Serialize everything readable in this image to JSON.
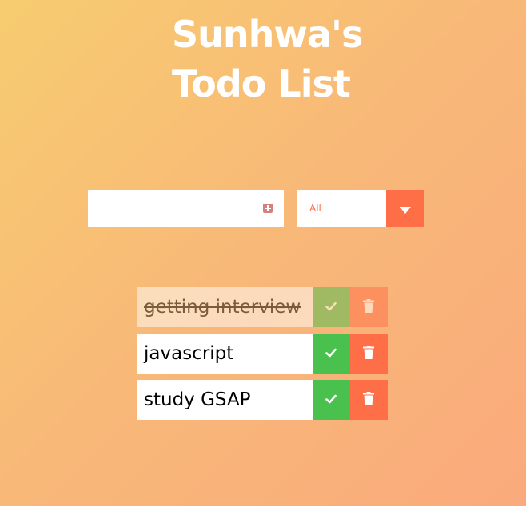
{
  "header": {
    "title_line1": "Sunhwa's",
    "title_line2": "Todo List"
  },
  "add_form": {
    "input_value": "",
    "add_icon": "plus-square-icon"
  },
  "filter": {
    "selected": "All",
    "arrow_icon": "caret-down-icon"
  },
  "todos": [
    {
      "text": "getting interview",
      "completed": true
    },
    {
      "text": "javascript",
      "completed": false
    },
    {
      "text": "study GSAP",
      "completed": false
    }
  ],
  "icons": {
    "complete": "check-icon",
    "delete": "trash-icon"
  },
  "colors": {
    "accent": "#ff6f47",
    "complete": "#4ac04e",
    "background_start": "#f7cc70",
    "background_end": "#faaa7c"
  }
}
